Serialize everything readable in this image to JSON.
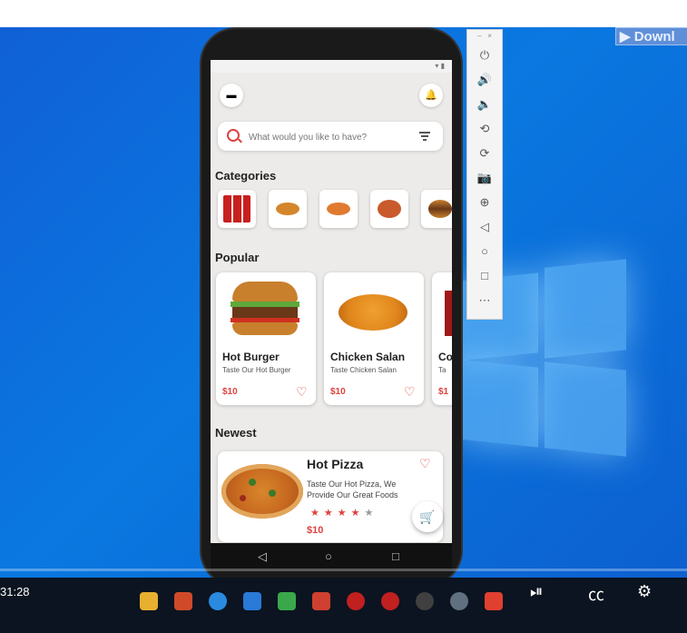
{
  "video": {
    "download_label": "▶ Downl",
    "time_label": "31:28"
  },
  "app": {
    "search_placeholder": "What would you like to have?",
    "sections": {
      "categories": "Categories",
      "popular": "Popular",
      "newest": "Newest"
    },
    "popular": [
      {
        "name": "Hot Burger",
        "desc": "Taste Our Hot Burger",
        "price": "$10"
      },
      {
        "name": "Chicken Salan",
        "desc": "Taste Chicken Salan",
        "price": "$10"
      },
      {
        "name": "Co",
        "desc": "Ta",
        "price": "$1"
      }
    ],
    "newest": {
      "name": "Hot Pizza",
      "desc": "Taste Our Hot Pizza, We Provide Our Great Foods",
      "price": "$10",
      "rating": 4,
      "max_rating": 5
    },
    "colors": {
      "accent": "#e04040"
    }
  }
}
